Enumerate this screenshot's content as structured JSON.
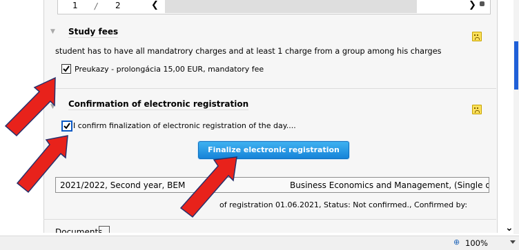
{
  "pager": {
    "page": "1",
    "separator": "/",
    "total": "2",
    "prev": "❮",
    "next": "❯"
  },
  "study_fees": {
    "title": "Study fees",
    "description": "student has to have all mandatrory charges and at least 1 charge from a group among his charges",
    "item_label": "Preukazy - prolongácia 15,00 EUR, mandatory fee",
    "item_checked": true
  },
  "confirmation": {
    "title": "Confirmation of electronic registration",
    "checkbox_label": "I confirm finalization of electronic registration of the day....",
    "checked": true,
    "button_label": "Finalize electronic registration"
  },
  "registration": {
    "field_left": "2021/2022, Second year, BEM",
    "field_right": "Business Economics and Management, (Single degree",
    "info": "of registration 01.06.2021, Status: Not confirmed., Confirmed by:"
  },
  "documents_label": "Documents",
  "statusbar": {
    "zoom": "100%"
  },
  "colors": {
    "arrow": "#e8221b",
    "arrow_outline": "#27306b",
    "button": "#1e8fe0"
  }
}
